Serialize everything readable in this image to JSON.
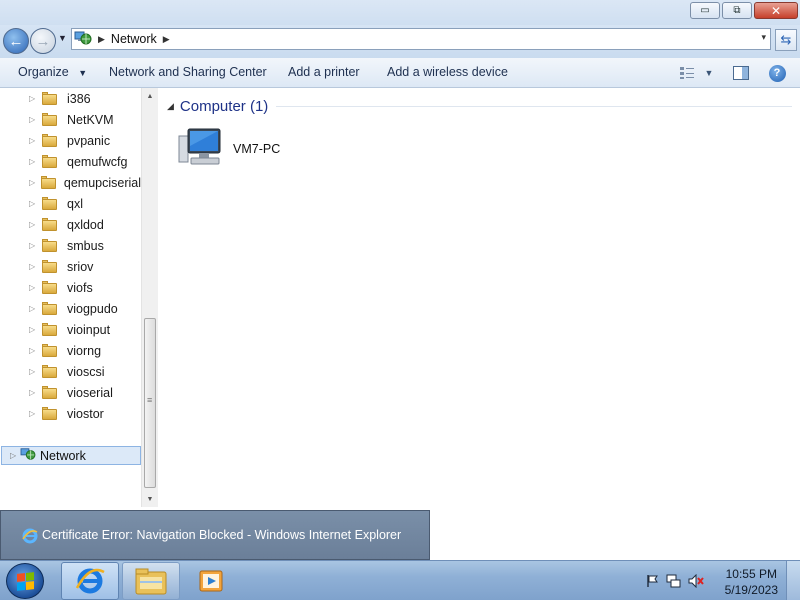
{
  "window": {
    "caption_buttons": {
      "minimize": "▭",
      "maximize": "⧉",
      "close": "✕"
    }
  },
  "address": {
    "location": "Network",
    "dropdown": "▾"
  },
  "toolbar": {
    "organize": "Organize",
    "network_sharing": "Network and Sharing Center",
    "add_printer": "Add a printer",
    "add_wireless": "Add a wireless device"
  },
  "nav_tree": {
    "folders": [
      "i386",
      "NetKVM",
      "pvpanic",
      "qemufwcfg",
      "qemupciserial",
      "qxl",
      "qxldod",
      "smbus",
      "sriov",
      "viofs",
      "viogpudo",
      "vioinput",
      "viorng",
      "vioscsi",
      "vioserial",
      "viostor"
    ],
    "selected": "Network"
  },
  "content": {
    "group_title": "Computer (1)",
    "items": [
      {
        "label": "VM7-PC",
        "icon": "computer-icon"
      }
    ]
  },
  "task_preview": {
    "label": "Certificate Error: Navigation Blocked - Windows Internet Explorer",
    "icon": "ie-icon"
  },
  "taskbar": {
    "apps": [
      "internet-explorer",
      "windows-explorer",
      "media-player"
    ]
  },
  "clock": {
    "time": "10:55 PM",
    "date": "5/19/2023"
  },
  "colors": {
    "accent": "#2c64b5",
    "group_title": "#1e3287",
    "taskbar": "#8fb0d6"
  }
}
